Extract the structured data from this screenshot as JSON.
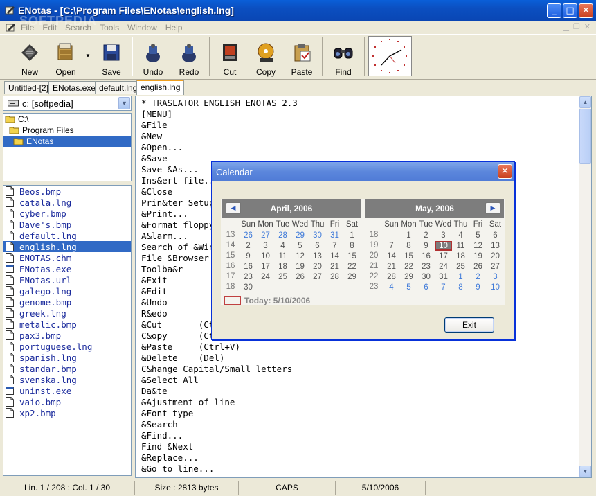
{
  "window": {
    "title": "ENotas - [C:\\Program Files\\ENotas\\english.lng]",
    "watermark": "SOFTPEDIA"
  },
  "menu": [
    "File",
    "Edit",
    "Search",
    "Tools",
    "Window",
    "Help"
  ],
  "toolbar": {
    "new": "New",
    "open": "Open",
    "save": "Save",
    "undo": "Undo",
    "redo": "Redo",
    "cut": "Cut",
    "copy": "Copy",
    "paste": "Paste",
    "find": "Find"
  },
  "tabs": [
    "Untitled-[2]",
    "ENotas.exe",
    "default.lng",
    "english.lng"
  ],
  "drive": "c: [softpedia]",
  "dirs": [
    "C:\\",
    "Program Files",
    "ENotas"
  ],
  "files": [
    "Beos.bmp",
    "catala.lng",
    "cyber.bmp",
    "Dave's.bmp",
    "default.lng",
    "english.lng",
    "ENOTAS.chm",
    "ENotas.exe",
    "ENotas.url",
    "galego.lng",
    "genome.bmp",
    "greek.lng",
    "metalic.bmp",
    "pax3.bmp",
    "portuguese.lng",
    "spanish.lng",
    "standar.bmp",
    "svenska.lng",
    "uninst.exe",
    "vaio.bmp",
    "xp2.bmp"
  ],
  "editor": {
    "lines": [
      "* TRASLATOR ENGLISH ENOTAS 2.3",
      "[MENU]",
      "&File",
      "&New",
      "&Open...",
      "&Save",
      "Save &As...",
      "Ins&ert file...",
      "&Close",
      "Prin&ter Setup...",
      "&Print...",
      "&Format floppy...",
      "A&larm...",
      "Search of &Windows...",
      "File &Browser",
      "Toolba&r",
      "&Exit",
      "&Edit",
      "&Undo",
      "R&edo",
      "&Cut       (Ctrl+X)",
      "C&opy      (Ctrl+C)",
      "&Paste     (Ctrl+V)",
      "&Delete    (Del)",
      "C&hange Capital/Small letters",
      "&Select All",
      "Da&te",
      "&Ajustment of line",
      "&Font type",
      "&Search",
      "&Find...",
      "Find &Next",
      "&Replace...",
      "&Go to line..."
    ]
  },
  "status": {
    "position": "Lin.  1 / 208 : Col.  1 / 30",
    "size": "Size : 2813 bytes",
    "caps": "CAPS",
    "date": "5/10/2006"
  },
  "calendar": {
    "title": "Calendar",
    "days": [
      "Sun",
      "Mon",
      "Tue",
      "Wed",
      "Thu",
      "Fri",
      "Sat"
    ],
    "left": {
      "name": "April, 2006",
      "weeks": [
        "13",
        "14",
        "15",
        "16",
        "17",
        "18"
      ],
      "rows": [
        [
          "26",
          "27",
          "28",
          "29",
          "30",
          "31",
          "1"
        ],
        [
          "2",
          "3",
          "4",
          "5",
          "6",
          "7",
          "8"
        ],
        [
          "9",
          "10",
          "11",
          "12",
          "13",
          "14",
          "15"
        ],
        [
          "16",
          "17",
          "18",
          "19",
          "20",
          "21",
          "22"
        ],
        [
          "23",
          "24",
          "25",
          "26",
          "27",
          "28",
          "29"
        ],
        [
          "30",
          "",
          "",
          "",
          "",
          "",
          ""
        ]
      ]
    },
    "right": {
      "name": "May, 2006",
      "weeks": [
        "18",
        "19",
        "20",
        "21",
        "22",
        "23"
      ],
      "rows": [
        [
          "",
          "1",
          "2",
          "3",
          "4",
          "5",
          "6"
        ],
        [
          "7",
          "8",
          "9",
          "10",
          "11",
          "12",
          "13"
        ],
        [
          "14",
          "15",
          "16",
          "17",
          "18",
          "19",
          "20"
        ],
        [
          "21",
          "22",
          "23",
          "24",
          "25",
          "26",
          "27"
        ],
        [
          "28",
          "29",
          "30",
          "31",
          "1",
          "2",
          "3"
        ],
        [
          "4",
          "5",
          "6",
          "7",
          "8",
          "9",
          "10"
        ]
      ]
    },
    "today_label": "Today: 5/10/2006",
    "exit": "Exit"
  }
}
